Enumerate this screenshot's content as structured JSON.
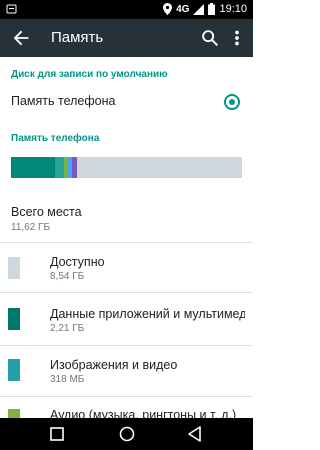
{
  "status_bar": {
    "network": "4G",
    "time": "19:10"
  },
  "app_bar": {
    "title": "Память"
  },
  "default_disk": {
    "header": "Диск для записи по умолчанию",
    "option_label": "Память телефона",
    "selected": true
  },
  "phone_storage": {
    "header": "Память телефона",
    "total_label": "Всего места",
    "total_value": "11,62 ГБ"
  },
  "usage_segments": [
    {
      "name": "apps",
      "fraction": 0.19,
      "color": "#00897b"
    },
    {
      "name": "images",
      "fraction": 0.04,
      "color": "#26a69a"
    },
    {
      "name": "audio",
      "fraction": 0.015,
      "color": "#7cb342"
    },
    {
      "name": "downloads",
      "fraction": 0.02,
      "color": "#42a5f5"
    },
    {
      "name": "misc",
      "fraction": 0.02,
      "color": "#7e57c2"
    }
  ],
  "items": [
    {
      "title": "Доступно",
      "value": "8,54 ГБ",
      "color": "#cfd8dc"
    },
    {
      "title": "Данные приложений и мультимед...",
      "value": "2,21 ГБ",
      "color": "#00796b"
    },
    {
      "title": "Изображения и видео",
      "value": "318 МБ",
      "color": "#26a0a8"
    },
    {
      "title": "Аудио (музыка, рингтоны и т. д.)",
      "value": "",
      "color": "#7cb342"
    }
  ]
}
